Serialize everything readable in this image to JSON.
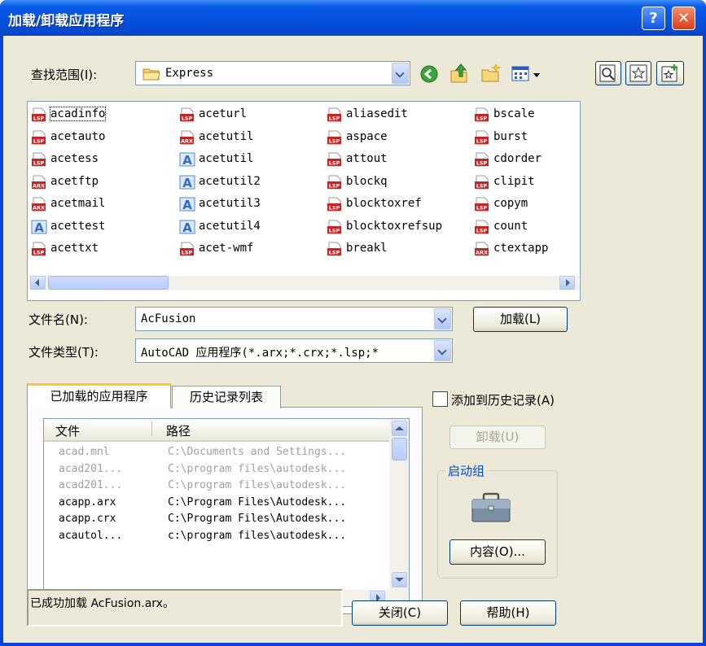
{
  "window": {
    "title": "加载/卸载应用程序",
    "help_glyph": "?",
    "close_glyph": "✕"
  },
  "look_in": {
    "label": "查找范围(I):",
    "value": "Express"
  },
  "files": [
    {
      "name": "acadinfo",
      "type": "LSP"
    },
    {
      "name": "acetauto",
      "type": "LSP"
    },
    {
      "name": "acetess",
      "type": "LSP"
    },
    {
      "name": "acetftp",
      "type": "ARX"
    },
    {
      "name": "acetmail",
      "type": "ARX"
    },
    {
      "name": "acettest",
      "type": "DVB"
    },
    {
      "name": "acettxt",
      "type": "LSP"
    },
    {
      "name": "aceturl",
      "type": "LSP"
    },
    {
      "name": "acetutil",
      "type": "ARX"
    },
    {
      "name": "acetutil",
      "type": "DVB"
    },
    {
      "name": "acetutil2",
      "type": "DVB"
    },
    {
      "name": "acetutil3",
      "type": "DVB"
    },
    {
      "name": "acetutil4",
      "type": "DVB"
    },
    {
      "name": "acet-wmf",
      "type": "LSP"
    },
    {
      "name": "aliasedit",
      "type": "LSP"
    },
    {
      "name": "aspace",
      "type": "LSP"
    },
    {
      "name": "attout",
      "type": "LSP"
    },
    {
      "name": "blockq",
      "type": "LSP"
    },
    {
      "name": "blocktoxref",
      "type": "LSP"
    },
    {
      "name": "blocktoxrefsup",
      "type": "LSP"
    },
    {
      "name": "breakl",
      "type": "LSP"
    },
    {
      "name": "bscale",
      "type": "LSP"
    },
    {
      "name": "burst",
      "type": "LSP"
    },
    {
      "name": "cdorder",
      "type": "LSP"
    },
    {
      "name": "clipit",
      "type": "LSP"
    },
    {
      "name": "copym",
      "type": "LSP"
    },
    {
      "name": "count",
      "type": "LSP"
    },
    {
      "name": "ctextapp",
      "type": "ARX"
    }
  ],
  "filename": {
    "label": "文件名(N):",
    "value": "AcFusion"
  },
  "filetype": {
    "label": "文件类型(T):",
    "value": "AutoCAD 应用程序(*.arx;*.crx;*.lsp;*"
  },
  "load_button": "加载(L)",
  "tabs": [
    {
      "label": "已加载的应用程序",
      "active": true
    },
    {
      "label": "历史记录列表",
      "active": false
    }
  ],
  "loaded_apps": {
    "columns": [
      "文件",
      "路径"
    ],
    "rows": [
      {
        "file": "acad.mnl",
        "path": "C:\\Documents and Settings...",
        "dim": true
      },
      {
        "file": "acad201...",
        "path": "C:\\program files\\autodesk...",
        "dim": true
      },
      {
        "file": "acad201...",
        "path": "C:\\program files\\autodesk...",
        "dim": true
      },
      {
        "file": "acapp.arx",
        "path": "C:\\Program Files\\Autodesk...",
        "dim": false
      },
      {
        "file": "acapp.crx",
        "path": "C:\\Program Files\\Autodesk...",
        "dim": false
      },
      {
        "file": "acautol...",
        "path": "c:\\program files\\autodesk...",
        "dim": false
      }
    ]
  },
  "add_to_history": {
    "label": "添加到历史记录(A)",
    "checked": false
  },
  "unload_button": "卸载(U)",
  "startup_suite": {
    "label": "启动组",
    "contents_button": "内容(O)..."
  },
  "status": "已成功加载 AcFusion.arx。",
  "close_button": "关闭(C)",
  "help_button": "帮助(H)",
  "colors": {
    "titlebar": "#0550dd",
    "dialog_bg": "#ece9d8",
    "lsp_icon": "#cc2222",
    "link_blue": "#0046d5"
  }
}
